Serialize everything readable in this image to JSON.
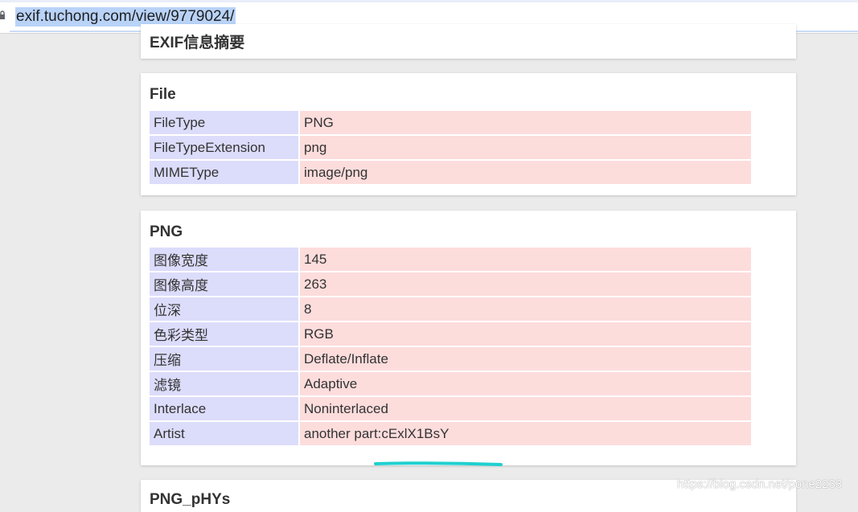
{
  "browser": {
    "url": "exif.tuchong.com/view/9779024/"
  },
  "cards": {
    "summary": {
      "title": "EXIF信息摘要"
    },
    "file": {
      "title": "File",
      "rows": [
        {
          "key": "FileType",
          "value": "PNG"
        },
        {
          "key": "FileTypeExtension",
          "value": "png"
        },
        {
          "key": "MIMEType",
          "value": "image/png"
        }
      ]
    },
    "png": {
      "title": "PNG",
      "rows": [
        {
          "key": "图像宽度",
          "value": "145"
        },
        {
          "key": "图像高度",
          "value": "263"
        },
        {
          "key": "位深",
          "value": "8"
        },
        {
          "key": "色彩类型",
          "value": "RGB"
        },
        {
          "key": "压缩",
          "value": "Deflate/Inflate"
        },
        {
          "key": "滤镜",
          "value": "Adaptive"
        },
        {
          "key": "Interlace",
          "value": "Noninterlaced"
        },
        {
          "key": "Artist",
          "value": "another part:cExlX1BsY"
        }
      ]
    },
    "pnghys": {
      "title": "PNG_pHYs"
    }
  },
  "watermark": "https://blog.csdn.net/pone2233",
  "colors": {
    "key_cell": "#dcdcfb",
    "value_cell": "#fddcdc",
    "highlight_stroke": "#1fd0d0"
  }
}
